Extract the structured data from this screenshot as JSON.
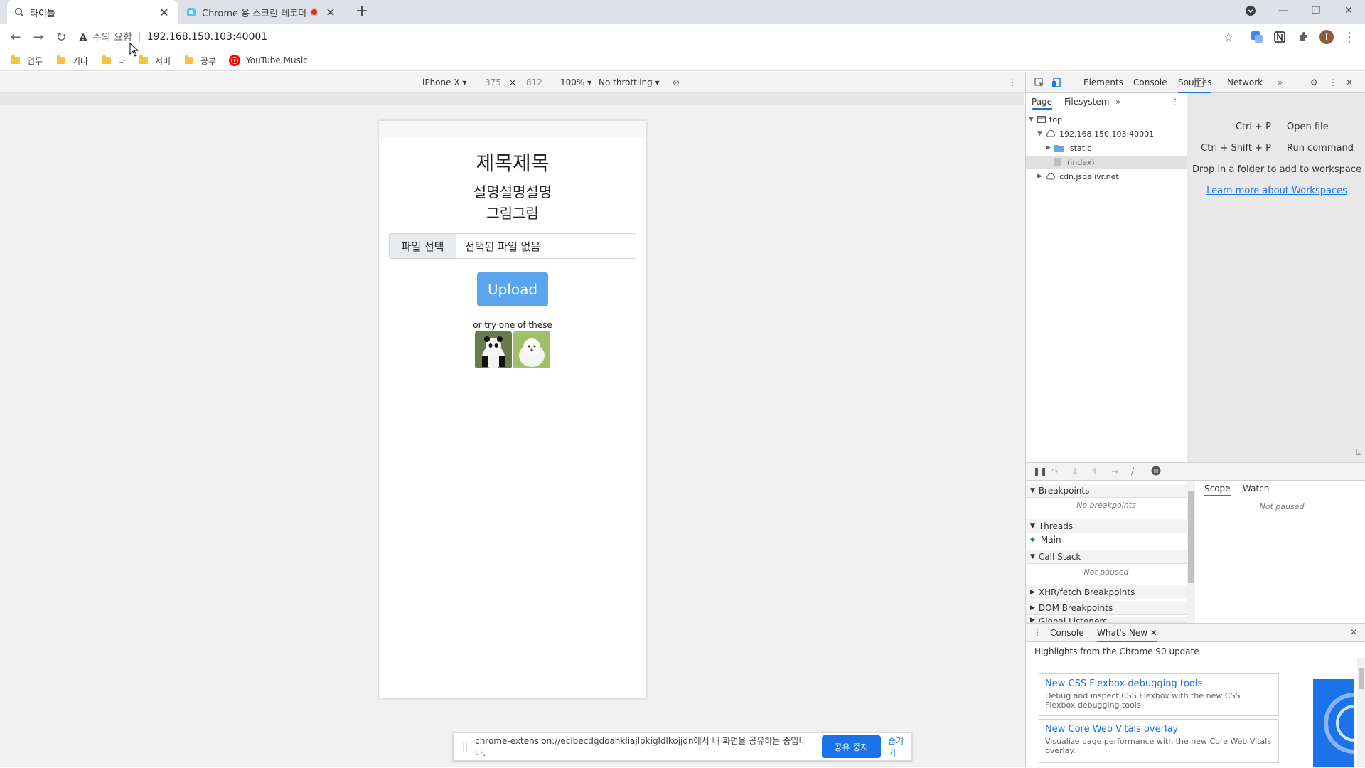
{
  "tabs": [
    {
      "title": "타이틀",
      "active": true
    },
    {
      "title": "Chrome 용 스크린 레코더",
      "active": false
    }
  ],
  "omnibox": {
    "warning": "주의 요함",
    "url": "192.168.150.103:40001"
  },
  "bookmarks": [
    "업무",
    "기타",
    "나",
    "서버",
    "공부",
    "YouTube Music"
  ],
  "device_toolbar": {
    "device": "iPhone X",
    "width": "375",
    "times": "×",
    "height": "812",
    "zoom": "100%",
    "throttling": "No throttling"
  },
  "page": {
    "title": "제목제목",
    "description": "설명설명설명",
    "picture_label": "그림그림",
    "file_button": "파일 선택",
    "file_status": "선택된 파일 없음",
    "upload": "Upload",
    "try_text": "or try one of these"
  },
  "devtools": {
    "tabs": [
      "Elements",
      "Console",
      "Sources",
      "Network"
    ],
    "active_tab": "Sources",
    "sources_tabs": [
      "Page",
      "Filesystem"
    ],
    "tree": [
      "top",
      "192.168.150.103:40001",
      "static",
      "(index)",
      "cdn.jsdelivr.net"
    ],
    "editor": {
      "shortcut1": "Ctrl + P",
      "action1": "Open file",
      "shortcut2": "Ctrl + Shift + P",
      "action2": "Run command",
      "drop_text": "Drop in a folder to add to workspace",
      "link": "Learn more about Workspaces"
    },
    "sections": {
      "breakpoints": "Breakpoints",
      "no_breakpoints": "No breakpoints",
      "threads": "Threads",
      "main": "Main",
      "callstack": "Call Stack",
      "not_paused": "Not paused",
      "xhr": "XHR/fetch Breakpoints",
      "dom": "DOM Breakpoints",
      "global": "Global Listeners"
    },
    "scope_tabs": [
      "Scope",
      "Watch"
    ],
    "scope_status": "Not paused",
    "drawer": {
      "tabs": [
        "Console",
        "What's New"
      ],
      "highlight": "Highlights from the Chrome 90 update",
      "cards": [
        {
          "title": "New CSS Flexbox debugging tools",
          "desc": "Debug and inspect CSS Flexbox with the new CSS Flexbox debugging tools."
        },
        {
          "title": "New Core Web Vitals overlay",
          "desc": "Visualize page performance with the new Core Web Vitals overlay."
        }
      ]
    }
  },
  "sharebar": {
    "message": "chrome-extension://eclbecdgdoahkliajlpkigldlkojjdn에서 내 화면을 공유하는 중입니다.",
    "stop": "공유 중지",
    "hide": "숨기기"
  },
  "colors": {
    "accent": "#1a73e8",
    "upload": "#5aa5ed",
    "record": "#d93025"
  }
}
